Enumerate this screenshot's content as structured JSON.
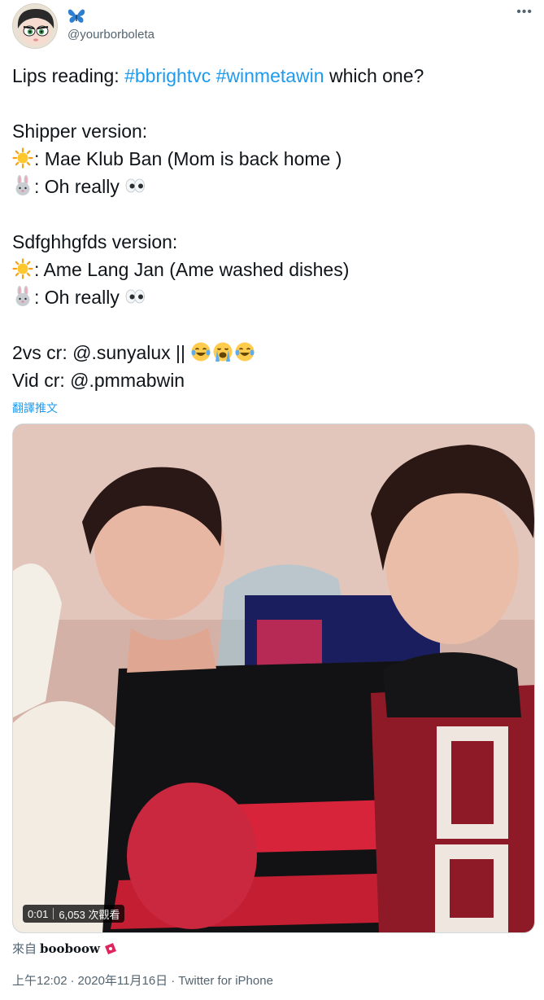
{
  "author": {
    "handle": "@yourborboleta",
    "avatar_icon": "powerpuff-avatar-icon",
    "name_icon": "butterfly-icon"
  },
  "more_label": "•••",
  "tweet": {
    "line1_prefix": "Lips reading: ",
    "hashtag1": "#bbrightvc",
    "hashtag2": "#winmetawin",
    "line1_suffix": " which one?",
    "shipper_heading": "Shipper version:",
    "shipper_sun": ": Mae Klub Ban (Mom is back home )",
    "shipper_rabbit": ": Oh really ",
    "sdf_heading": "Sdfghhgfds version:",
    "sdf_sun": ": Ame Lang Jan (Ame washed dishes)",
    "sdf_rabbit": ": Oh really ",
    "credit1": "2vs cr: @.sunyalux || ",
    "credit2": "Vid cr: @.pmmabwin"
  },
  "translate_label": "翻譯推文",
  "video": {
    "elapsed": "0:01",
    "views": "6,053 次觀看"
  },
  "source": {
    "prefix": "來自",
    "app_name": "booboow",
    "app_icon": "ticket-icon"
  },
  "meta": {
    "time": "上午12:02",
    "date": "2020年11月16日",
    "client": "Twitter for iPhone",
    "separator": "·"
  },
  "colors": {
    "link": "#1d9bf0",
    "text": "#0f1419",
    "secondary": "#536471"
  }
}
